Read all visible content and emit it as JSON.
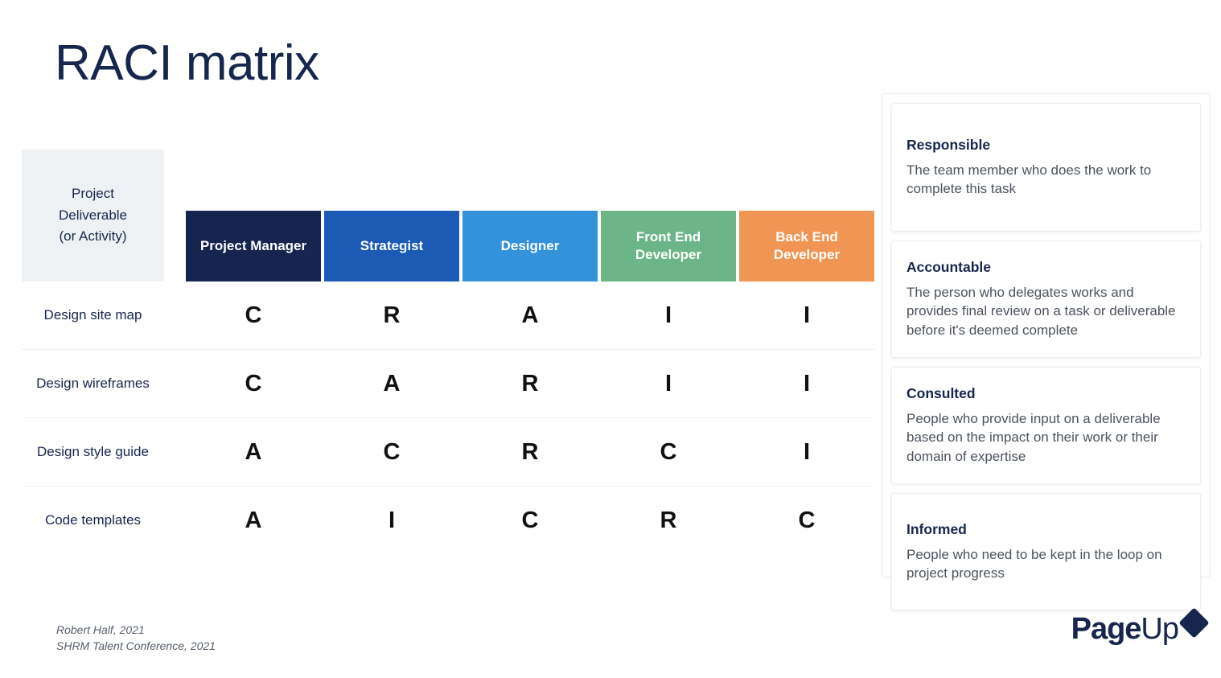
{
  "title": "RACI matrix",
  "matrix": {
    "corner_label": "Project\nDeliverable\n(or Activity)",
    "corner_lines": [
      "Project",
      "Deliverable",
      "(or Activity)"
    ],
    "columns": [
      {
        "label": "Project Manager",
        "color": "#16254f"
      },
      {
        "label": "Strategist",
        "color": "#1b5bb5"
      },
      {
        "label": "Designer",
        "color": "#3492db"
      },
      {
        "label": "Front End Developer",
        "color": "#6cb586"
      },
      {
        "label": "Back End Developer",
        "color": "#f09553"
      }
    ],
    "rows": [
      {
        "label": "Design site map",
        "values": [
          "C",
          "R",
          "A",
          "I",
          "I"
        ]
      },
      {
        "label": "Design wireframes",
        "values": [
          "C",
          "A",
          "R",
          "I",
          "I"
        ]
      },
      {
        "label": "Design style guide",
        "values": [
          "A",
          "C",
          "R",
          "C",
          "I"
        ]
      },
      {
        "label": "Code templates",
        "values": [
          "A",
          "I",
          "C",
          "R",
          "C"
        ]
      }
    ]
  },
  "legend": {
    "cards": [
      {
        "term": "Responsible",
        "description": "The team member who does the work to complete this task"
      },
      {
        "term": "Accountable",
        "description": "The person who delegates works and provides final review on a task or deliverable before it's deemed complete"
      },
      {
        "term": "Consulted",
        "description": "People who provide input on a deliverable based on the impact on their work or their domain of expertise"
      },
      {
        "term": "Informed",
        "description": "People who need to be kept in the loop on project progress"
      }
    ]
  },
  "footer": {
    "citation_line_1": "Robert Half, 2021",
    "citation_line_2": "SHRM Talent Conference, 2021",
    "logo_bold": "Page",
    "logo_light": "Up"
  },
  "colors": {
    "navy": "#17264f",
    "corner_bg": "#eef1f3",
    "body_text": "#4c535e",
    "divider": "#f0f0f2"
  }
}
